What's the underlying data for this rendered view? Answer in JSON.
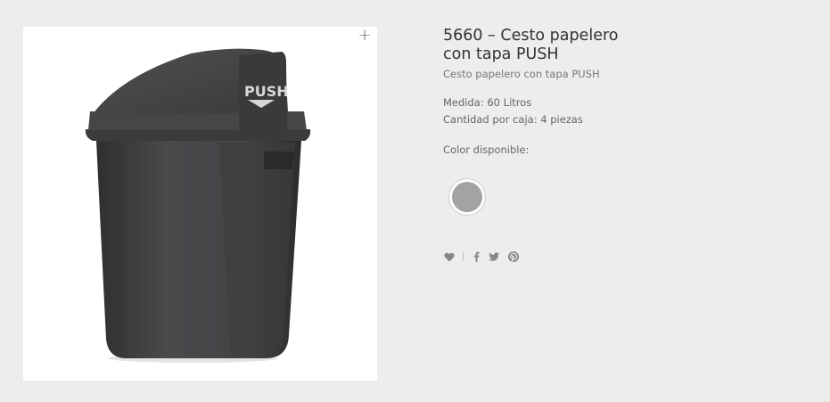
{
  "gallery": {
    "zoom_icon": "plus-icon",
    "image_text": "PUSH"
  },
  "product": {
    "title_line1": "5660 – Cesto papelero",
    "title_line2": "con tapa PUSH",
    "subtitle": "Cesto papelero con tapa PUSH",
    "measure": "Medida: 60 Litros",
    "quantity": "Cantidad por caja: 4 piezas",
    "color_label": "Color disponible:",
    "swatch_color": "#a3a3a3"
  },
  "share": {
    "icons": [
      "heart-icon",
      "facebook-icon",
      "twitter-icon",
      "pinterest-icon"
    ]
  }
}
